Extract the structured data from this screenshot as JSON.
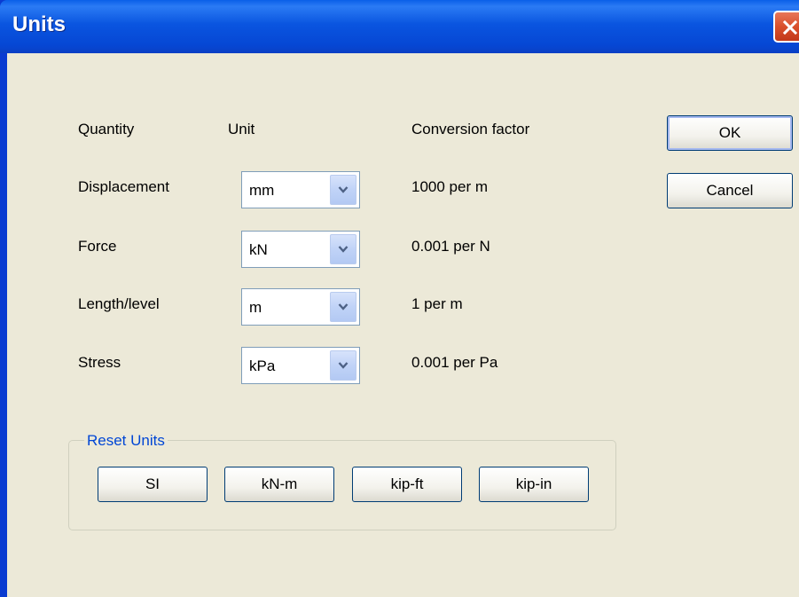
{
  "window": {
    "title": "Units"
  },
  "headers": {
    "quantity": "Quantity",
    "unit": "Unit",
    "conversion": "Conversion factor"
  },
  "rows": [
    {
      "quantity": "Displacement",
      "unit": "mm",
      "factor": "1000 per m"
    },
    {
      "quantity": "Force",
      "unit": "kN",
      "factor": "0.001 per N"
    },
    {
      "quantity": "Length/level",
      "unit": "m",
      "factor": "1 per m"
    },
    {
      "quantity": "Stress",
      "unit": "kPa",
      "factor": "0.001 per Pa"
    }
  ],
  "buttons": {
    "ok": "OK",
    "cancel": "Cancel"
  },
  "reset_units": {
    "title": "Reset Units",
    "options": [
      "SI",
      "kN-m",
      "kip-ft",
      "kip-in"
    ]
  },
  "colors": {
    "titlebar": "#0a55e0",
    "dialog_bg": "#ece9d8",
    "group_title": "#0046d5",
    "close_button": "#d9502c"
  },
  "icons": {
    "close": "close-icon",
    "dropdown": "chevron-down-icon"
  }
}
